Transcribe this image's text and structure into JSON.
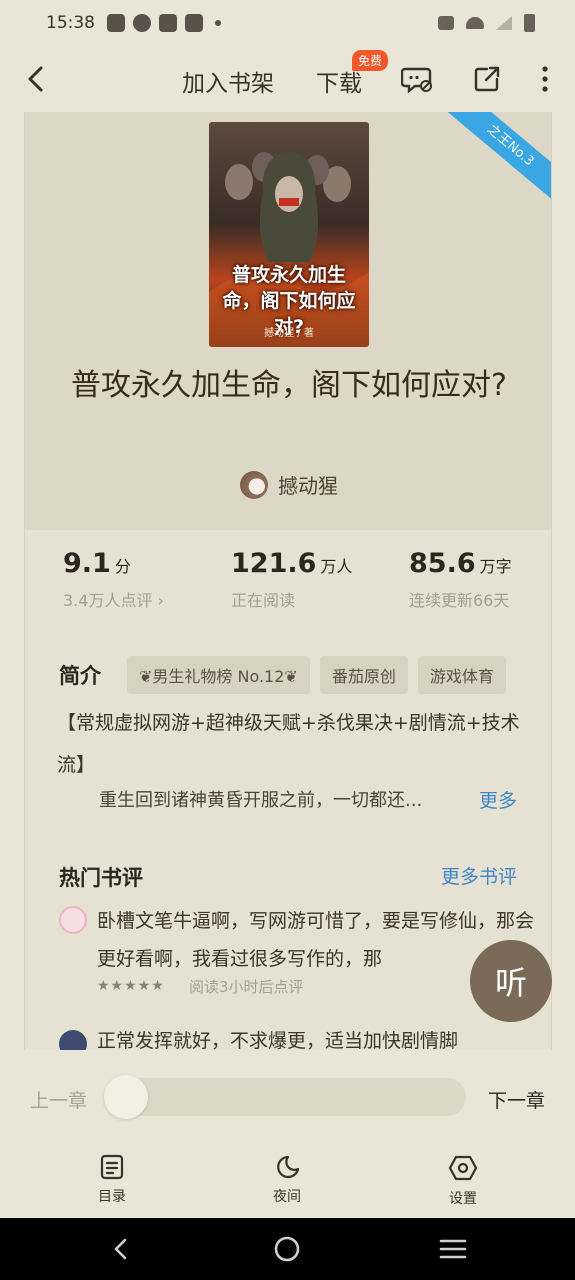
{
  "status_bar": {
    "time": "15:38"
  },
  "nav": {
    "add_shelf": "加入书架",
    "download": "下载",
    "free_badge": "免费"
  },
  "book": {
    "title": "普攻永久加生命，阁下如何应对?",
    "author": "撼动猩",
    "cover_title": "普攻永久加生命，阁下如何应对?",
    "cover_author": "撼动猩 / 著",
    "ribbon": "之王No.3"
  },
  "stats": [
    {
      "value": "9.1",
      "unit": "分",
      "sub": "3.4万人点评 ›"
    },
    {
      "value": "121.6",
      "unit": "万人",
      "sub": "正在阅读"
    },
    {
      "value": "85.6",
      "unit": "万字",
      "sub": "连续更新66天"
    }
  ],
  "intro": {
    "title": "简介",
    "tags": [
      "❦男生礼物榜 No.12❦",
      "番茄原创",
      "游戏体育"
    ],
    "text1": "【常规虚拟网游+超神级天赋+杀伐果决+剧情流+技术流】",
    "text2": "重生回到诸神黄昏开服之前，一切都还...",
    "more": "更多"
  },
  "reviews": {
    "title": "热门书评",
    "more": "更多书评",
    "items": [
      {
        "text": "卧槽文笔牛逼啊，写网游可惜了，要是写修仙，那会更好看啊，我看过很多写作的，那",
        "stars": "★★★★★",
        "meta": "阅读3小时后点评"
      },
      {
        "text": "正常发挥就好，不求爆更，适当加快剧情脚"
      }
    ]
  },
  "listen": "听",
  "reader": {
    "prev": "上一章",
    "next": "下一章",
    "progress": 0.0
  },
  "toolbar": {
    "toc": "目录",
    "night": "夜间",
    "settings": "设置"
  },
  "colors": {
    "background": "#e9e5d7",
    "accent_link": "#3f86c8",
    "badge": "#f2562a",
    "listen_button": "#7a6a58"
  }
}
